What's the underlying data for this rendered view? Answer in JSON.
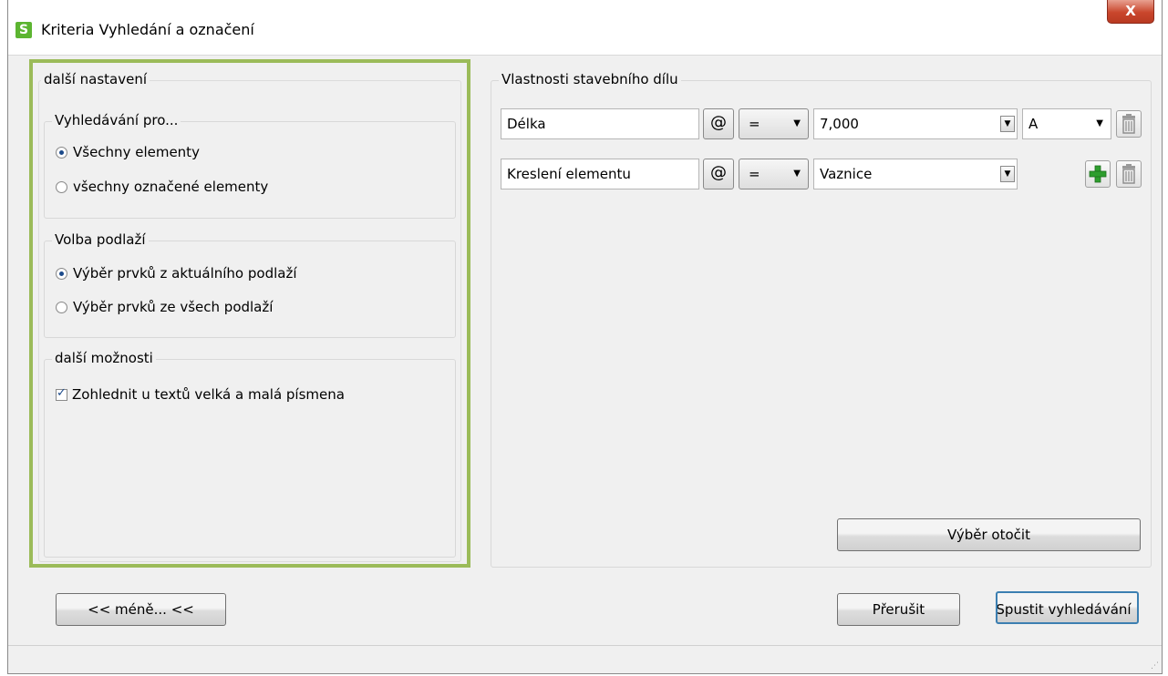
{
  "window": {
    "title": "Kriteria Vyhledání a označení",
    "icon_letter": "S",
    "close_glyph": "X"
  },
  "left_panel": {
    "legend": "další nastavení",
    "search_for": {
      "legend": "Vyhledávání pro...",
      "options": [
        "Všechny elementy",
        "všechny označené elementy"
      ],
      "selected": 0
    },
    "floor": {
      "legend": "Volba podlaží",
      "options": [
        "Výběr prvků z aktuálního podlaží",
        "Výběr prvků ze všech podlaží"
      ],
      "selected": 0
    },
    "more": {
      "legend": "další možnosti",
      "case_sensitive_label": "Zohlednit u textů velká a malá písmena",
      "case_sensitive_checked": true
    }
  },
  "right_panel": {
    "legend": "Vlastnosti stavebního dílu",
    "rows": [
      {
        "property": "Délka",
        "at": "@",
        "operator": "=",
        "value": "7,000",
        "logic": "A"
      },
      {
        "property": "Kreslení elementu",
        "at": "@",
        "operator": "=",
        "value": "Vaznice"
      }
    ],
    "invert_button": "Výběr otočit"
  },
  "footer": {
    "less_button": "<< méně... <<",
    "cancel_button": "Přerušit",
    "start_button": "Spustit vyhledávání"
  },
  "colors": {
    "highlight_border": "#9bbb59",
    "add_icon": "#2e9e2e",
    "close_button": "#c9462c"
  }
}
